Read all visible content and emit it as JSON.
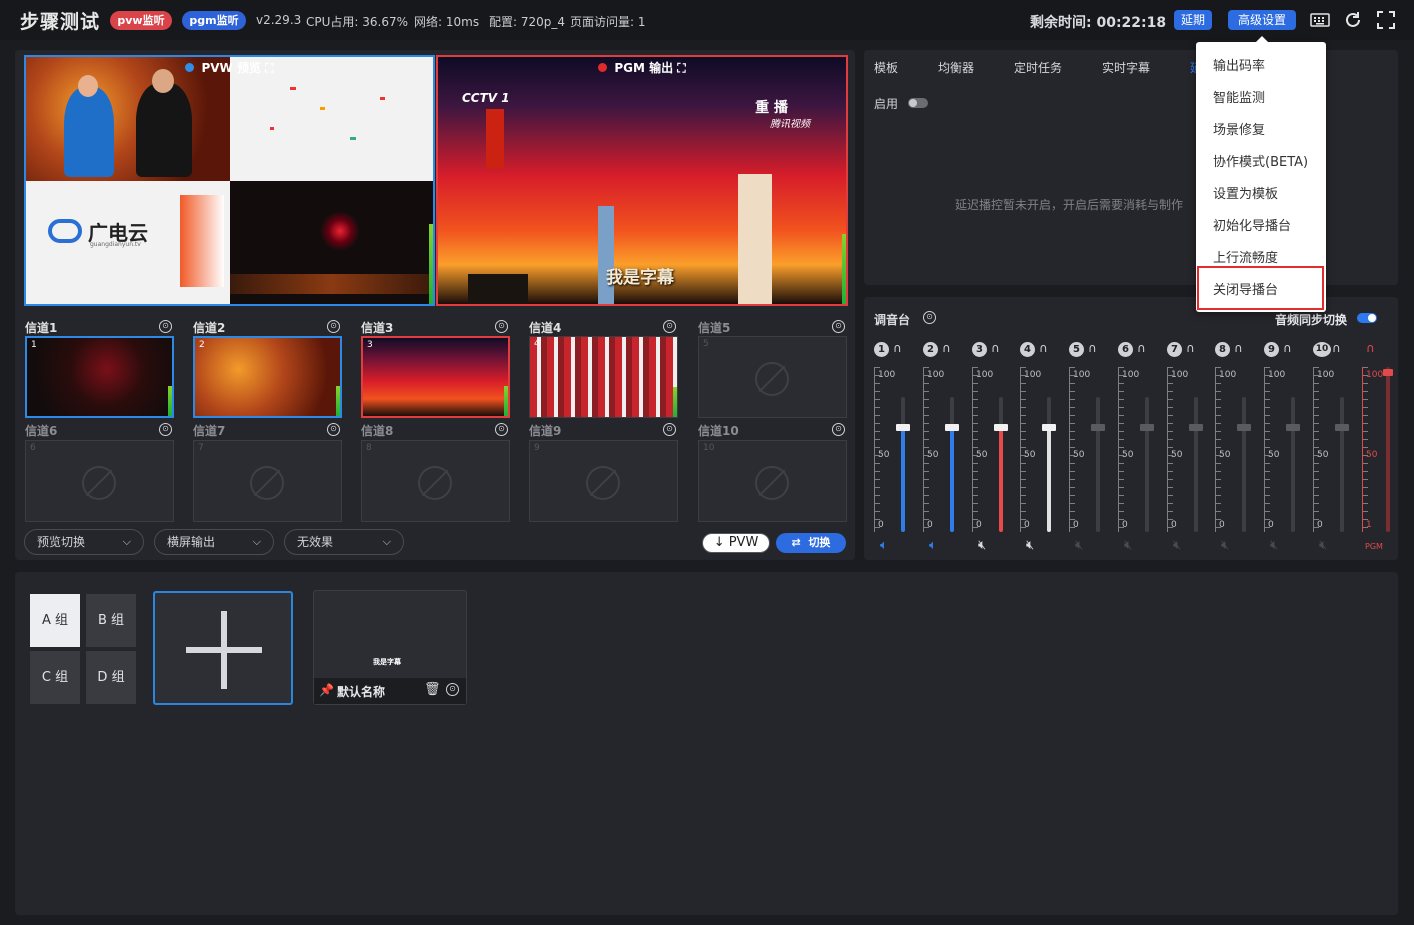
{
  "header": {
    "app_title": "步骤测试",
    "pvw_monitor": "pvw监听",
    "pgm_monitor": "pgm监听",
    "version": "v2.29.3",
    "cpu": "CPU占用: 36.67%",
    "network": "网络: 10ms",
    "config": "配置: 720p_4",
    "page_visits": "页面访问量: 1",
    "remaining_time": "剩余时间: 00:22:18",
    "delay_button": "延期",
    "advanced_button": "高级设置",
    "icons": [
      "keyboard-icon",
      "refresh-icon",
      "fullscreen-icon"
    ]
  },
  "monitors": {
    "pvw_label": "PVW 预览",
    "pgm_label": "PGM 输出",
    "pgm_caption": "我是字幕",
    "pgm_station": "CCTV 1",
    "pgm_badge": "重 播",
    "pgm_sub": "腾讯视频",
    "pvw_logo_text": "广电云",
    "pvw_logo_sub": "guangdianyun.tv"
  },
  "channels": [
    {
      "label": "信道1",
      "num": "1",
      "state": "pvw"
    },
    {
      "label": "信道2",
      "num": "2",
      "state": "live"
    },
    {
      "label": "信道3",
      "num": "3",
      "state": "pgm"
    },
    {
      "label": "信道4",
      "num": "4",
      "state": "live"
    },
    {
      "label": "信道5",
      "num": "5",
      "state": "empty"
    },
    {
      "label": "信道6",
      "num": "6",
      "state": "empty"
    },
    {
      "label": "信道7",
      "num": "7",
      "state": "empty"
    },
    {
      "label": "信道8",
      "num": "8",
      "state": "empty"
    },
    {
      "label": "信道9",
      "num": "9",
      "state": "empty"
    },
    {
      "label": "信道10",
      "num": "10",
      "state": "empty"
    }
  ],
  "controls": {
    "preview_switch": "预览切换",
    "output_mode": "横屏输出",
    "effect": "无效果",
    "pvw_button": "↓ PVW",
    "switch_button": "切换"
  },
  "tabs": [
    "模板",
    "均衡器",
    "定时任务",
    "实时字幕",
    "延"
  ],
  "tab_panel": {
    "enable_label": "启用",
    "enabled": false,
    "delay_message": "延迟播控暂未开启，开启后需要消耗与制作"
  },
  "mixer": {
    "title": "调音台",
    "sync_label": "音频同步切换",
    "sync_enabled": true,
    "scale_top": "100",
    "scale_mid": "50",
    "scale_bottom": "0",
    "pgm_scale_bottom": "1",
    "pgm_tag": "PGM",
    "channels": [
      {
        "num": "1",
        "level": 0.78,
        "color": "#2f7de8",
        "active": true
      },
      {
        "num": "2",
        "level": 0.78,
        "color": "#2f7de8",
        "active": true
      },
      {
        "num": "3",
        "level": 0.78,
        "color": "#e84a4a",
        "active": true
      },
      {
        "num": "4",
        "level": 0.78,
        "color": "#e2e2e2",
        "active": true
      },
      {
        "num": "5",
        "level": 0.78,
        "color": "#3d3e44",
        "active": false
      },
      {
        "num": "6",
        "level": 0.78,
        "color": "#3d3e44",
        "active": false
      },
      {
        "num": "7",
        "level": 0.78,
        "color": "#3d3e44",
        "active": false
      },
      {
        "num": "8",
        "level": 0.78,
        "color": "#3d3e44",
        "active": false
      },
      {
        "num": "9",
        "level": 0.78,
        "color": "#3d3e44",
        "active": false
      },
      {
        "num": "10",
        "level": 0.78,
        "color": "#3d3e44",
        "active": false
      }
    ],
    "pgm_level": 0.97
  },
  "advanced_menu": {
    "items": [
      "输出码率",
      "智能监测",
      "场景修复",
      "协作模式(BETA)",
      "设置为模板",
      "初始化导播台",
      "上行流畅度",
      "关闭导播台"
    ],
    "highlighted": "关闭导播台"
  },
  "scenes": {
    "groups": [
      "A 组",
      "B 组",
      "C 组",
      "D 组"
    ],
    "active_group": "A 组",
    "card_caption": "我是字幕",
    "card_name": "默认名称"
  },
  "colors": {
    "accent": "#2d6be0",
    "pvw": "#2c8ae6",
    "pgm": "#e23c3c"
  }
}
